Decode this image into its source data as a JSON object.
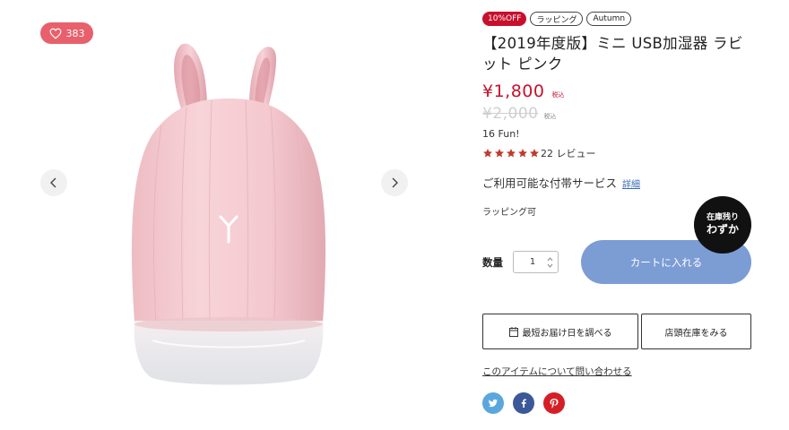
{
  "gallery": {
    "favorite_count": "383",
    "colors": {
      "favorite_bg": "#e8606b"
    }
  },
  "product": {
    "badges": [
      "10%OFF",
      "ラッピング",
      "Autumn"
    ],
    "title": "【2019年度版】ミニ USB加湿器 ラビット ピンク",
    "price": "¥1,800",
    "price_tax_label": "税込",
    "old_price": "¥2,000",
    "old_price_tax_label": "税込",
    "brand_line": "16 Fun!",
    "rating_stars": 5,
    "review_text": "22 レビュー",
    "service_text": "ご利用可能な付帯サービス",
    "service_link": "詳細",
    "wrapping_text": "ラッピング可",
    "colors": {
      "sale": "#c8102e",
      "cart": "#7c9cd4",
      "star": "#c0392b"
    }
  },
  "purchase": {
    "qty_label": "数量",
    "qty_value": "1",
    "cart_button": "カートに入れる",
    "stock_badge_line1": "在庫残り",
    "stock_badge_line2": "わずか",
    "delivery_button": "最短お届け日を調べる",
    "store_button": "店頭在庫をみる",
    "inquiry_link": "このアイテムについて問い合わせる"
  },
  "social": {
    "icons": [
      "twitter-icon",
      "facebook-icon",
      "pinterest-icon"
    ]
  }
}
